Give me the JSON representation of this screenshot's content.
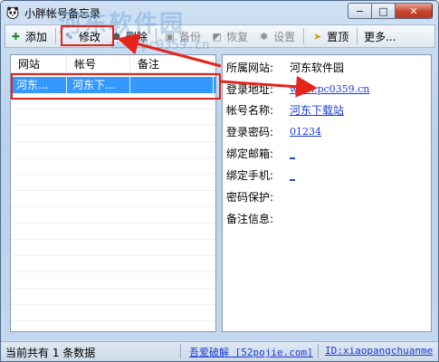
{
  "window": {
    "title": "小胖帐号备忘录"
  },
  "titlebar": {
    "minimize": "−",
    "maximize": "□",
    "close": "✕"
  },
  "toolbar": {
    "items": [
      {
        "label": "添加",
        "icon": "add-icon",
        "enabled": true
      },
      {
        "label": "修改",
        "icon": "edit-icon",
        "enabled": true
      },
      {
        "label": "删除",
        "icon": "delete-icon",
        "enabled": true
      },
      {
        "label": "备份",
        "icon": "backup-icon",
        "enabled": false
      },
      {
        "label": "恢复",
        "icon": "restore-icon",
        "enabled": false
      },
      {
        "label": "设置",
        "icon": "gear-icon",
        "enabled": false
      },
      {
        "label": "置顶",
        "icon": "pin-icon",
        "enabled": true
      },
      {
        "label": "更多...",
        "icon": "",
        "enabled": true
      }
    ]
  },
  "list": {
    "headers": [
      "网站",
      "帐号",
      "备注"
    ],
    "rows": [
      {
        "site": "河东...",
        "account": "河东下...",
        "note": ""
      }
    ]
  },
  "detail": {
    "fields": [
      {
        "label": "所属网站:",
        "value": "河东软件园",
        "link": false
      },
      {
        "label": "登录地址:",
        "value": "www.pc0359.cn",
        "link": true
      },
      {
        "label": "帐号名称:",
        "value": "河东下载站",
        "link": true
      },
      {
        "label": "登录密码:",
        "value": "01234",
        "link": true
      },
      {
        "label": "绑定邮箱:",
        "value": "_",
        "link": true
      },
      {
        "label": "绑定手机:",
        "value": "_",
        "link": true
      },
      {
        "label": "密码保护:",
        "value": "",
        "link": false
      },
      {
        "label": "备注信息:",
        "value": "",
        "link": false
      }
    ]
  },
  "status": {
    "count_text": "当前共有 1 条数据",
    "forum_link": "吾爱破解 [52pojie.com]",
    "id_link": "ID:xiaopangchuanme"
  },
  "watermark": {
    "logo_text": "河东软件园",
    "url": "www.pc0359.cn"
  },
  "colors": {
    "accent": "#3399ff",
    "annotation": "#e3241b",
    "link": "#1a3bd6"
  }
}
